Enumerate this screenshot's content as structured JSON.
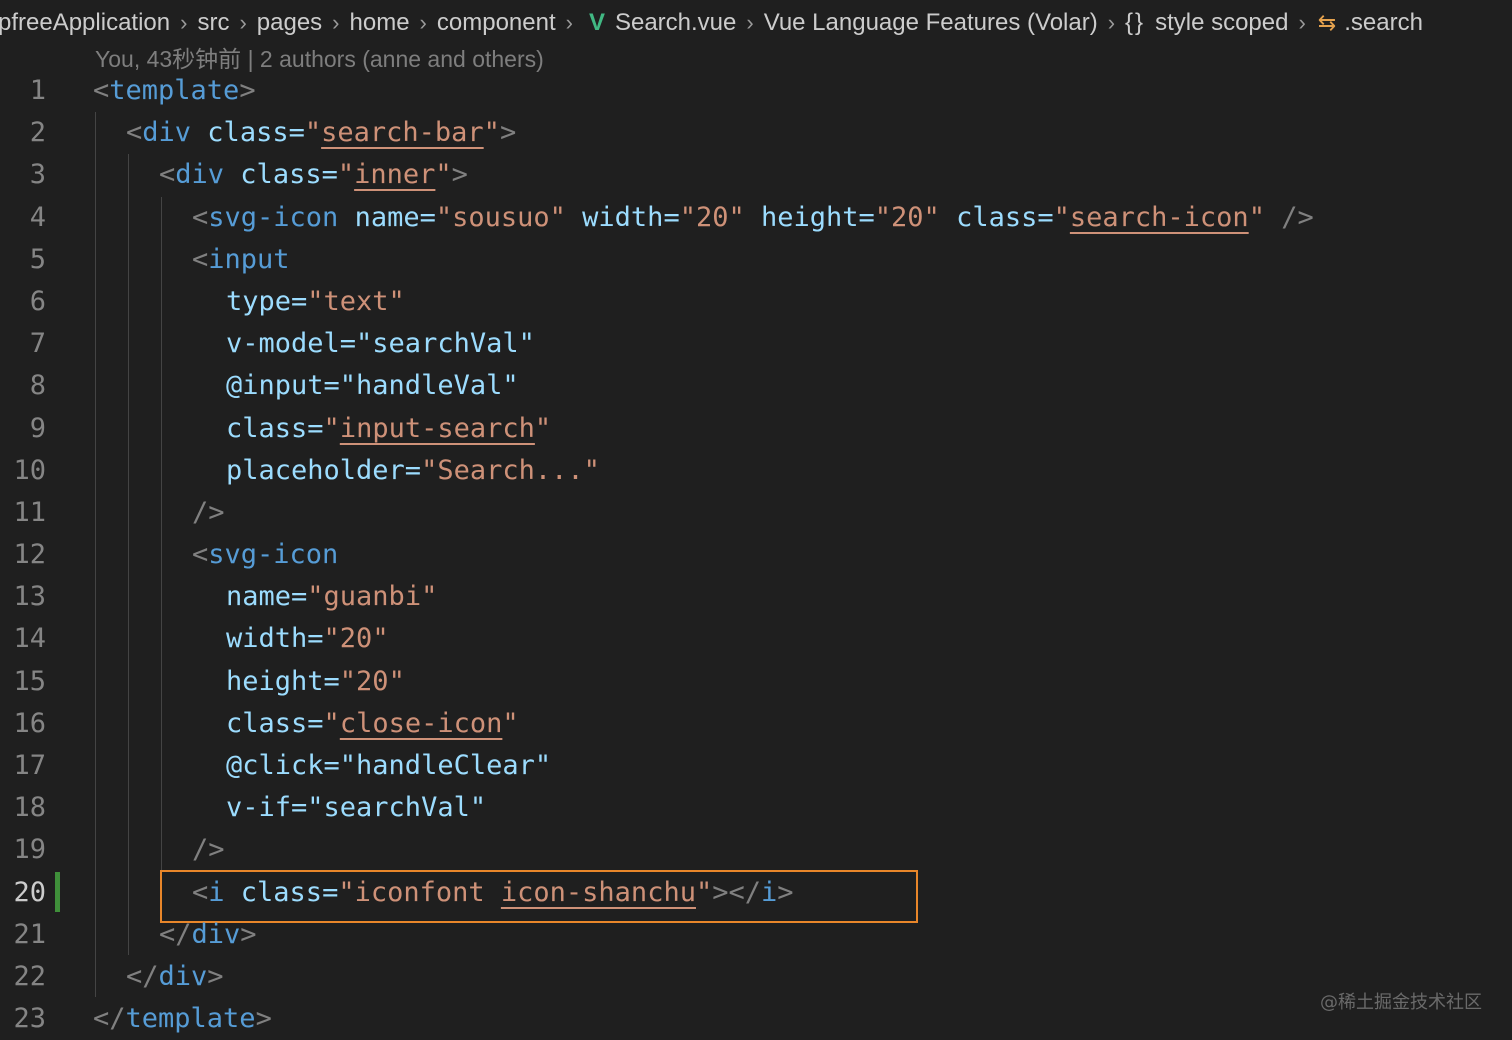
{
  "breadcrumb": {
    "items": [
      "pfreeApplication",
      "src",
      "pages",
      "home",
      "component",
      "Search.vue",
      "Vue Language Features (Volar)",
      "{}",
      "style scoped",
      ".search"
    ]
  },
  "blame": "You, 43秒钟前 | 2 authors (anne and others)",
  "line_numbers": [
    "1",
    "2",
    "3",
    "4",
    "5",
    "6",
    "7",
    "8",
    "9",
    "10",
    "11",
    "12",
    "13",
    "14",
    "15",
    "16",
    "17",
    "18",
    "19",
    "20",
    "21",
    "22",
    "23"
  ],
  "code": {
    "l1": [
      "<",
      "template",
      ">"
    ],
    "l2": [
      "<",
      "div",
      " class=",
      "\"",
      "search-bar",
      "\"",
      ">"
    ],
    "l3": [
      "<",
      "div",
      " class=",
      "\"",
      "inner",
      "\"",
      ">"
    ],
    "l4": [
      "<",
      "svg-icon",
      " name=",
      "\"sousuo\"",
      " width=",
      "\"20\"",
      " height=",
      "\"20\"",
      " class=",
      "\"",
      "search-icon",
      "\"",
      " />"
    ],
    "l5": [
      "<",
      "input"
    ],
    "l6": [
      "type=",
      "\"text\""
    ],
    "l7": [
      "v-model=\"searchVal\""
    ],
    "l8": [
      "@input=\"handleVal\""
    ],
    "l9": [
      "class=",
      "\"",
      "input-search",
      "\""
    ],
    "l10": [
      "placeholder=",
      "\"Search...\""
    ],
    "l11": [
      "/>"
    ],
    "l12": [
      "<",
      "svg-icon"
    ],
    "l13": [
      "name=",
      "\"guanbi\""
    ],
    "l14": [
      "width=",
      "\"20\""
    ],
    "l15": [
      "height=",
      "\"20\""
    ],
    "l16": [
      "class=",
      "\"",
      "close-icon",
      "\""
    ],
    "l17": [
      "@click=\"handleClear\""
    ],
    "l18": [
      "v-if=\"searchVal\""
    ],
    "l19": [
      "/>"
    ],
    "l20": [
      "<",
      "i",
      " class=",
      "\"iconfont ",
      "icon-shanchu",
      "\"",
      "></",
      "i",
      ">"
    ],
    "l21": [
      "</",
      "div",
      ">"
    ],
    "l22": [
      "</",
      "div",
      ">"
    ],
    "l23": [
      "</",
      "template",
      ">"
    ]
  },
  "watermark": "@稀土掘金技术社区",
  "colors": {
    "background": "#1f1f1f",
    "tag": "#569cd6",
    "attribute": "#9cdcfe",
    "string": "#ce9178",
    "punctuation": "#808080",
    "highlight_border": "#e8862a",
    "git_added": "#3f8f3a",
    "vue_icon": "#41b883"
  },
  "icons": [
    "chevron-right-icon",
    "vue-logo-icon",
    "braces-icon",
    "symbol-class-icon"
  ]
}
